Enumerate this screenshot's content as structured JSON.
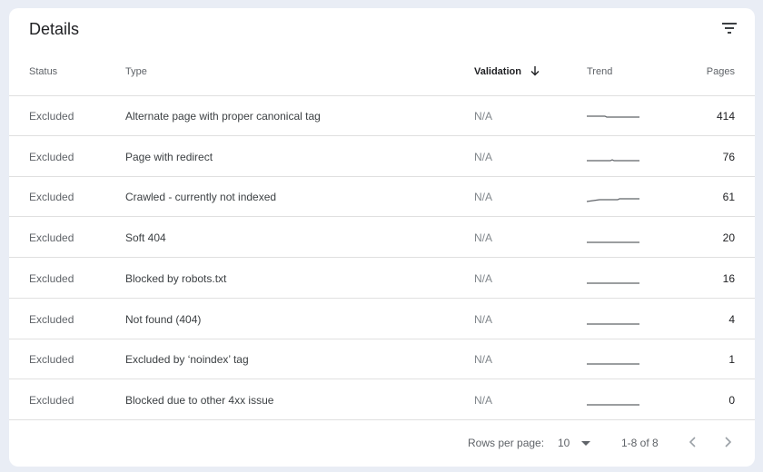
{
  "card": {
    "title": "Details",
    "filter_icon": "filter-list-icon"
  },
  "columns": {
    "status": "Status",
    "type": "Type",
    "validation": "Validation",
    "validation_sort_icon": "arrow-down-icon",
    "trend": "Trend",
    "pages": "Pages"
  },
  "rows": [
    {
      "status": "Excluded",
      "type": "Alternate page with proper canonical tag",
      "validation": "N/A",
      "pages": "414"
    },
    {
      "status": "Excluded",
      "type": "Page with redirect",
      "validation": "N/A",
      "pages": "76"
    },
    {
      "status": "Excluded",
      "type": "Crawled - currently not indexed",
      "validation": "N/A",
      "pages": "61"
    },
    {
      "status": "Excluded",
      "type": "Soft 404",
      "validation": "N/A",
      "pages": "20"
    },
    {
      "status": "Excluded",
      "type": "Blocked by robots.txt",
      "validation": "N/A",
      "pages": "16"
    },
    {
      "status": "Excluded",
      "type": "Not found (404)",
      "validation": "N/A",
      "pages": "4"
    },
    {
      "status": "Excluded",
      "type": "Excluded by ‘noindex’ tag",
      "validation": "N/A",
      "pages": "1"
    },
    {
      "status": "Excluded",
      "type": "Blocked due to other 4xx issue",
      "validation": "N/A",
      "pages": "0"
    }
  ],
  "footer": {
    "rows_per_page_label": "Rows per page:",
    "rows_per_page_value": "10",
    "range": "1-8 of 8",
    "prev_icon": "chevron-left-icon",
    "next_icon": "chevron-right-icon"
  },
  "colors": {
    "background": "#e9edf5",
    "card": "#ffffff",
    "divider": "#e0e0e0",
    "sparkline": "#5f6368"
  }
}
